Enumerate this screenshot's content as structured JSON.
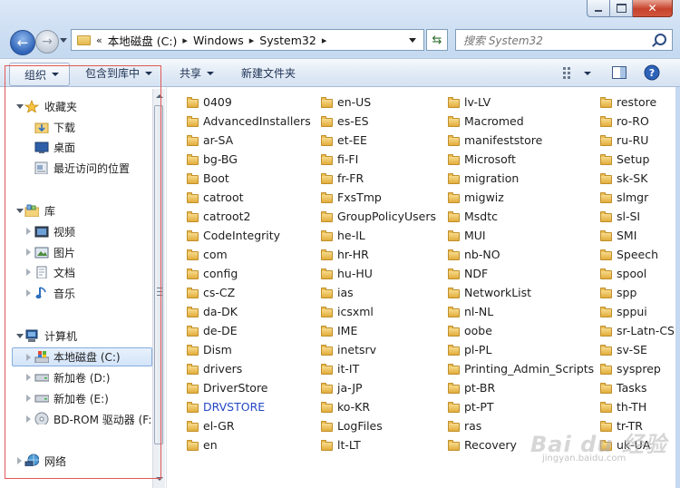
{
  "caption_buttons": [
    "minimize",
    "maximize",
    "close"
  ],
  "address": {
    "overflow": "«",
    "crumbs": [
      "本地磁盘 (C:)",
      "Windows",
      "System32"
    ]
  },
  "search": {
    "placeholder": "搜索 System32"
  },
  "toolbar": {
    "organize": "组织",
    "include_in_library": "包含到库中",
    "share": "共享",
    "new_folder": "新建文件夹"
  },
  "nav": {
    "favorites": {
      "label": "收藏夹",
      "items": [
        "下载",
        "桌面",
        "最近访问的位置"
      ]
    },
    "libraries": {
      "label": "库",
      "items": [
        "视频",
        "图片",
        "文档",
        "音乐"
      ]
    },
    "computer": {
      "label": "计算机",
      "items": [
        "本地磁盘 (C:)",
        "新加卷 (D:)",
        "新加卷 (E:)",
        "BD-ROM 驱动器 (F:"
      ]
    },
    "network": {
      "label": "网络"
    }
  },
  "files": {
    "col1": [
      "0409",
      "AdvancedInstallers",
      "ar-SA",
      "bg-BG",
      "Boot",
      "catroot",
      "catroot2",
      "CodeIntegrity",
      "com",
      "config",
      "cs-CZ",
      "da-DK",
      "de-DE",
      "Dism",
      "drivers",
      "DriverStore",
      "DRVSTORE",
      "el-GR",
      "en"
    ],
    "col2": [
      "en-US",
      "es-ES",
      "et-EE",
      "fi-FI",
      "fr-FR",
      "FxsTmp",
      "GroupPolicyUsers",
      "he-IL",
      "hr-HR",
      "hu-HU",
      "ias",
      "icsxml",
      "IME",
      "inetsrv",
      "it-IT",
      "ja-JP",
      "ko-KR",
      "LogFiles",
      "lt-LT"
    ],
    "col3": [
      "lv-LV",
      "Macromed",
      "manifeststore",
      "Microsoft",
      "migration",
      "migwiz",
      "Msdtc",
      "MUI",
      "nb-NO",
      "NDF",
      "NetworkList",
      "nl-NL",
      "oobe",
      "pl-PL",
      "Printing_Admin_Scripts",
      "pt-BR",
      "pt-PT",
      "ras",
      "Recovery"
    ],
    "col4": [
      "restore",
      "ro-RO",
      "ru-RU",
      "Setup",
      "sk-SK",
      "slmgr",
      "sl-SI",
      "SMI",
      "Speech",
      "spool",
      "spp",
      "sppui",
      "sr-Latn-CS",
      "sv-SE",
      "sysprep",
      "Tasks",
      "th-TH",
      "tr-TR",
      "uk-UA"
    ],
    "link_item": "DRVSTORE"
  },
  "watermark": {
    "brand": "Bai du 经验",
    "url": "jingyan.baidu.com"
  },
  "colors": {
    "link": "#2548c6",
    "folder": "#e2ad3c",
    "selection_border": "#84acdd",
    "highlight_box": "#e05858"
  }
}
